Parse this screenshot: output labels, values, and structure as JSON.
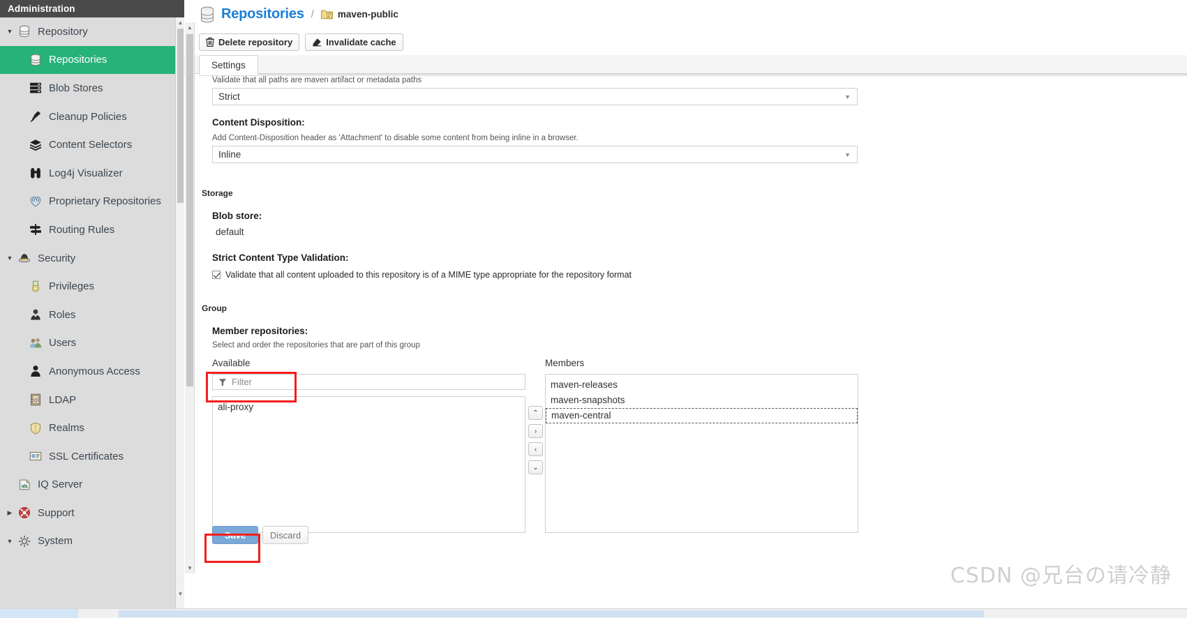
{
  "sidebar": {
    "header": "Administration",
    "items": [
      {
        "label": "Repository",
        "icon": "database-icon",
        "level": "group",
        "expanded": true,
        "selected": false
      },
      {
        "label": "Repositories",
        "icon": "database-icon",
        "level": "child",
        "selected": true
      },
      {
        "label": "Blob Stores",
        "icon": "server-stack-icon",
        "level": "child",
        "selected": false
      },
      {
        "label": "Cleanup Policies",
        "icon": "broom-icon",
        "level": "child",
        "selected": false
      },
      {
        "label": "Content Selectors",
        "icon": "layers-icon",
        "level": "child",
        "selected": false
      },
      {
        "label": "Log4j Visualizer",
        "icon": "binoculars-icon",
        "level": "child",
        "selected": false
      },
      {
        "label": "Proprietary Repositories",
        "icon": "proprietary-icon",
        "level": "child",
        "selected": false
      },
      {
        "label": "Routing Rules",
        "icon": "signpost-icon",
        "level": "child",
        "selected": false
      },
      {
        "label": "Security",
        "icon": "security-hat-icon",
        "level": "group",
        "expanded": true,
        "selected": false
      },
      {
        "label": "Privileges",
        "icon": "medal-icon",
        "level": "child",
        "selected": false
      },
      {
        "label": "Roles",
        "icon": "role-person-icon",
        "level": "child",
        "selected": false
      },
      {
        "label": "Users",
        "icon": "users-icon",
        "level": "child",
        "selected": false
      },
      {
        "label": "Anonymous Access",
        "icon": "person-icon",
        "level": "child",
        "selected": false
      },
      {
        "label": "LDAP",
        "icon": "address-book-icon",
        "level": "child",
        "selected": false
      },
      {
        "label": "Realms",
        "icon": "shield-icon",
        "level": "child",
        "selected": false
      },
      {
        "label": "SSL Certificates",
        "icon": "certificate-icon",
        "level": "child",
        "selected": false
      },
      {
        "label": "IQ Server",
        "icon": "iq-server-icon",
        "level": "group",
        "expanded": null,
        "selected": false
      },
      {
        "label": "Support",
        "icon": "lifebuoy-icon",
        "level": "group",
        "expanded": false,
        "selected": false
      },
      {
        "label": "System",
        "icon": "gear-icon",
        "level": "group",
        "expanded": true,
        "selected": false
      }
    ]
  },
  "breadcrumb": {
    "root": "Repositories",
    "separator": "/",
    "current": "maven-public"
  },
  "toolbar": {
    "delete_label": "Delete repository",
    "invalidate_label": "Invalidate cache"
  },
  "tabs": [
    {
      "label": "Settings",
      "active": true
    }
  ],
  "form": {
    "layout_policy": {
      "helper": "Validate that all paths are maven artifact or metadata paths",
      "value": "Strict"
    },
    "content_disposition": {
      "label": "Content Disposition:",
      "helper": "Add Content-Disposition header as 'Attachment' to disable some content from being inline in a browser.",
      "value": "Inline"
    },
    "storage": {
      "section_title": "Storage",
      "blob_store_label": "Blob store:",
      "blob_store_value": "default",
      "strict_validation_label": "Strict Content Type Validation:",
      "strict_validation_checkbox_label": "Validate that all content uploaded to this repository is of a MIME type appropriate for the repository format",
      "strict_validation_checked": true
    },
    "group": {
      "section_title": "Group",
      "member_repositories_label": "Member repositories:",
      "member_repositories_helper": "Select and order the repositories that are part of this group",
      "available_heading": "Available",
      "members_heading": "Members",
      "filter_placeholder": "Filter",
      "filter_value": "",
      "available_items": [
        "ali-proxy"
      ],
      "member_items": [
        {
          "label": "maven-releases",
          "focused": false
        },
        {
          "label": "maven-snapshots",
          "focused": false
        },
        {
          "label": "maven-central",
          "focused": true
        }
      ],
      "transfer_buttons": [
        {
          "name": "move-up-button",
          "glyph": "⌃"
        },
        {
          "name": "move-right-button",
          "glyph": "›"
        },
        {
          "name": "move-left-button",
          "glyph": "‹"
        },
        {
          "name": "move-down-button",
          "glyph": "⌄"
        }
      ]
    },
    "actions": {
      "save_label": "Save",
      "discard_label": "Discard"
    }
  },
  "watermark": "CSDN @兄台の请冷静",
  "colors": {
    "sidebar_bg": "#dcdcdc",
    "sidebar_header_bg": "#4a4a4a",
    "selected_item_bg": "#27b278",
    "breadcrumb_link": "#1c7ed6",
    "save_button_bg": "#7aa8d7",
    "annotation_red": "#f41d1d"
  }
}
